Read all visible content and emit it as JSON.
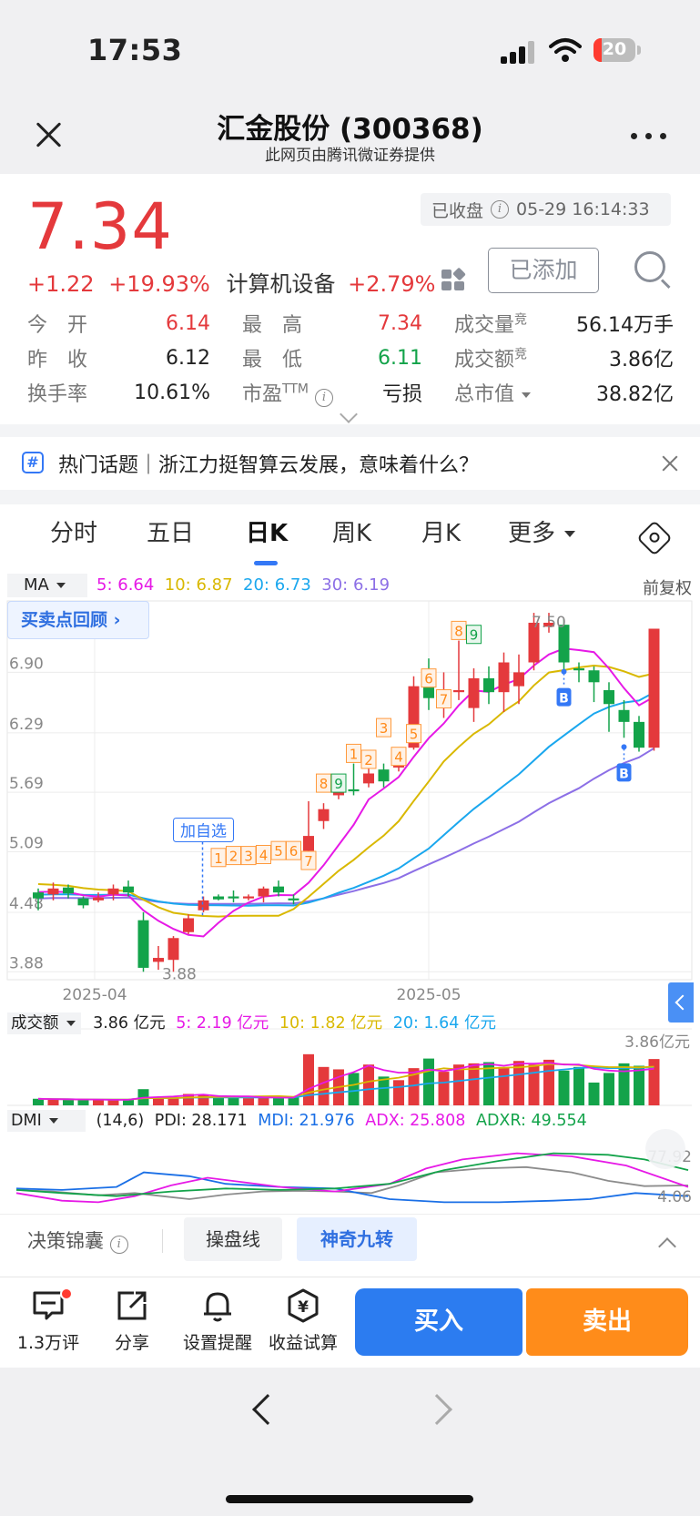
{
  "status": {
    "time": "17:53",
    "battery": "20"
  },
  "nav": {
    "title": "汇金股份 (300368)",
    "subtitle": "此网页由腾讯微证券提供"
  },
  "quote": {
    "price": "7.34",
    "change": "+1.22",
    "change_pct": "+19.93%",
    "industry": "计算机设备",
    "industry_pct": "+2.79%",
    "market_status": "已收盘",
    "datetime": "05-29 16:14:33",
    "added_label": "已添加"
  },
  "stats": {
    "open_label": "今　开",
    "open": "6.14",
    "high_label": "最　高",
    "high": "7.34",
    "volume_label": "成交量",
    "volume": "56.14万手",
    "prev_close_label": "昨　收",
    "prev_close": "6.12",
    "low_label": "最　低",
    "low": "6.11",
    "amount_label": "成交额",
    "amount": "3.86亿",
    "turnover_label": "换手率",
    "turnover": "10.61%",
    "pe_label": "市盈",
    "pe_sup": "TTM",
    "pe": "亏损",
    "mktcap_label": "总市值",
    "mktcap": "38.82亿",
    "auction_mark": "竞"
  },
  "topic": {
    "text": "热门话题｜浙江力挺智算云发展，意味着什么？"
  },
  "tabs": [
    "分时",
    "五日",
    "日K",
    "周K",
    "月K",
    "更多"
  ],
  "active_tab": "日K",
  "ma_legend": {
    "selector": "MA",
    "ma5": "5: 6.64",
    "ma10": "10: 6.87",
    "ma20": "20: 6.73",
    "ma30": "30: 6.19",
    "adjust": "前复权"
  },
  "review_button": "买卖点回顾 ›",
  "colors": {
    "up": "#e4393c",
    "down": "#13a34a",
    "ma5": "#e619e6",
    "ma10": "#d9b800",
    "ma20": "#1aa7ee",
    "ma30": "#8c6fe6",
    "accent": "#2c7cf0",
    "sell": "#ff8c1a"
  },
  "chart_data": {
    "type": "candlestick",
    "price_ticks": [
      "6.90",
      "6.29",
      "5.69",
      "5.09",
      "4.48",
      "3.88"
    ],
    "x_labels": [
      "2025-04",
      "2025-05"
    ],
    "low_annotation": "3.88",
    "high_annotation": "7.50",
    "add_watch_label": "加自选",
    "signal_label": "B",
    "sequence_marks": [
      "1",
      "2",
      "3",
      "4",
      "5",
      "6",
      "7",
      "8",
      "9",
      "1",
      "2",
      "3",
      "4",
      "5",
      "6",
      "7",
      "8",
      "9"
    ],
    "candles": [
      {
        "o": 4.68,
        "c": 4.62,
        "h": 4.72,
        "l": 4.5
      },
      {
        "o": 4.66,
        "c": 4.72,
        "h": 4.78,
        "l": 4.6
      },
      {
        "o": 4.73,
        "c": 4.67,
        "h": 4.76,
        "l": 4.62
      },
      {
        "o": 4.62,
        "c": 4.55,
        "h": 4.64,
        "l": 4.52
      },
      {
        "o": 4.6,
        "c": 4.63,
        "h": 4.68,
        "l": 4.58
      },
      {
        "o": 4.66,
        "c": 4.72,
        "h": 4.76,
        "l": 4.6
      },
      {
        "o": 4.74,
        "c": 4.68,
        "h": 4.8,
        "l": 4.64
      },
      {
        "o": 4.4,
        "c": 3.92,
        "h": 4.48,
        "l": 3.88
      },
      {
        "o": 3.98,
        "c": 4.02,
        "h": 4.14,
        "l": 3.9
      },
      {
        "o": 4.0,
        "c": 4.22,
        "h": 4.24,
        "l": 3.88
      },
      {
        "o": 4.28,
        "c": 4.42,
        "h": 4.46,
        "l": 4.26
      },
      {
        "o": 4.5,
        "c": 4.6,
        "h": 4.64,
        "l": 4.48
      },
      {
        "o": 4.64,
        "c": 4.61,
        "h": 4.66,
        "l": 4.6
      },
      {
        "o": 4.64,
        "c": 4.62,
        "h": 4.7,
        "l": 4.58
      },
      {
        "o": 4.62,
        "c": 4.64,
        "h": 4.66,
        "l": 4.6
      },
      {
        "o": 4.64,
        "c": 4.72,
        "h": 4.74,
        "l": 4.58
      },
      {
        "o": 4.74,
        "c": 4.68,
        "h": 4.8,
        "l": 4.64
      },
      {
        "o": 4.62,
        "c": 4.6,
        "h": 4.66,
        "l": 4.56
      },
      {
        "o": 5.1,
        "c": 5.25,
        "h": 5.6,
        "l": 5.05
      },
      {
        "o": 5.4,
        "c": 5.52,
        "h": 5.58,
        "l": 5.32
      },
      {
        "o": 5.66,
        "c": 5.74,
        "h": 5.82,
        "l": 5.62
      },
      {
        "o": 5.72,
        "c": 5.7,
        "h": 5.98,
        "l": 5.66
      },
      {
        "o": 5.78,
        "c": 5.88,
        "h": 6.0,
        "l": 5.74
      },
      {
        "o": 5.92,
        "c": 5.8,
        "h": 5.98,
        "l": 5.74
      },
      {
        "o": 5.94,
        "c": 6.1,
        "h": 6.14,
        "l": 5.9
      },
      {
        "o": 6.14,
        "c": 6.76,
        "h": 6.86,
        "l": 6.12
      },
      {
        "o": 6.82,
        "c": 6.64,
        "h": 7.04,
        "l": 6.52
      },
      {
        "o": 6.55,
        "c": 6.62,
        "h": 6.9,
        "l": 6.44
      },
      {
        "o": 6.7,
        "c": 6.72,
        "h": 7.22,
        "l": 6.62
      },
      {
        "o": 6.54,
        "c": 6.84,
        "h": 6.94,
        "l": 6.4
      },
      {
        "o": 6.84,
        "c": 6.7,
        "h": 6.96,
        "l": 6.58
      },
      {
        "o": 6.7,
        "c": 7.0,
        "h": 7.1,
        "l": 6.5
      },
      {
        "o": 6.76,
        "c": 6.9,
        "h": 7.08,
        "l": 6.58
      },
      {
        "o": 7.0,
        "c": 7.4,
        "h": 7.5,
        "l": 6.92
      },
      {
        "o": 7.36,
        "c": 7.4,
        "h": 7.5,
        "l": 7.3
      },
      {
        "o": 7.38,
        "c": 7.0,
        "h": 7.44,
        "l": 6.92
      },
      {
        "o": 6.94,
        "c": 6.92,
        "h": 7.0,
        "l": 6.8
      },
      {
        "o": 6.92,
        "c": 6.8,
        "h": 6.96,
        "l": 6.6
      },
      {
        "o": 6.72,
        "c": 6.58,
        "h": 6.8,
        "l": 6.3
      },
      {
        "o": 6.52,
        "c": 6.4,
        "h": 6.62,
        "l": 6.24
      },
      {
        "o": 6.4,
        "c": 6.14,
        "h": 6.46,
        "l": 6.1
      },
      {
        "o": 6.14,
        "c": 7.34,
        "h": 7.34,
        "l": 6.11
      }
    ],
    "volume": {
      "selector": "成交额",
      "legend_now": "3.86 亿元",
      "ma5": "5: 2.19 亿元",
      "ma10": "10: 1.82 亿元",
      "ma20": "20: 1.64 亿元",
      "max_label": "3.86亿元",
      "values": [
        0.55,
        0.5,
        0.48,
        0.45,
        0.44,
        0.46,
        0.48,
        1.35,
        0.72,
        0.66,
        0.95,
        0.85,
        0.7,
        0.62,
        0.6,
        0.62,
        0.7,
        0.68,
        4.26,
        3.2,
        3.0,
        2.7,
        3.4,
        2.4,
        2.1,
        3.1,
        3.9,
        2.8,
        3.4,
        3.5,
        3.6,
        3.2,
        3.7,
        3.4,
        3.8,
        2.9,
        3.2,
        1.9,
        2.7,
        3.5,
        3.3,
        3.86
      ]
    },
    "dmi": {
      "selector": "DMI",
      "params": "(14,6)",
      "pdi": "PDI: 28.171",
      "mdi": "MDI: 21.976",
      "adx": "ADX: 25.808",
      "adxr": "ADXR: 49.554",
      "top_label": "77.92",
      "bottom_label": "4.06"
    }
  },
  "strategy": {
    "label": "决策锦囊",
    "option1": "操盘线",
    "option2": "神奇九转"
  },
  "actions": {
    "comments": "1.3万评",
    "share": "分享",
    "alert": "设置提醒",
    "calc": "收益试算",
    "buy": "买入",
    "sell": "卖出"
  }
}
